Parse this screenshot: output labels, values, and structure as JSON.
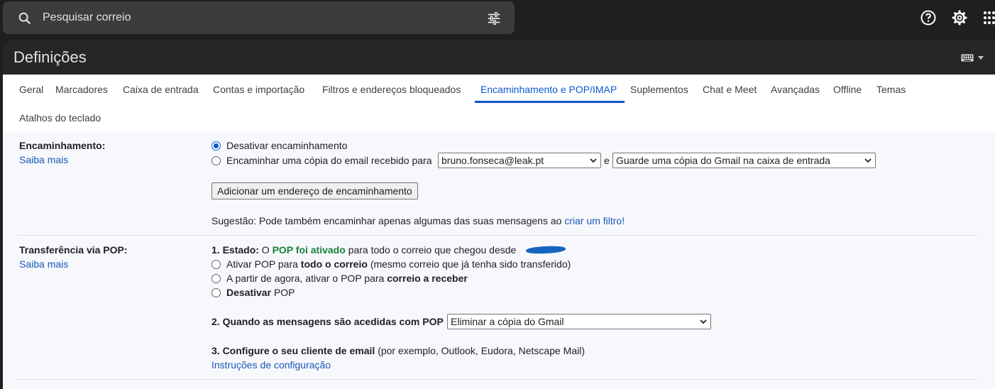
{
  "search": {
    "placeholder": "Pesquisar correio"
  },
  "header": {
    "title": "Definições"
  },
  "tabs": [
    {
      "label": "Geral"
    },
    {
      "label": "Marcadores"
    },
    {
      "label": "Caixa de entrada"
    },
    {
      "label": "Contas e importação"
    },
    {
      "label": "Filtros e endereços bloqueados"
    },
    {
      "label": "Encaminhamento e POP/IMAP",
      "active": true
    },
    {
      "label": "Suplementos"
    },
    {
      "label": "Chat e Meet"
    },
    {
      "label": "Avançadas"
    },
    {
      "label": "Offline"
    },
    {
      "label": "Temas"
    },
    {
      "label": "Atalhos do teclado"
    }
  ],
  "forwarding": {
    "label": "Encaminhamento:",
    "learn_more": "Saiba mais",
    "opt_disable": "Desativar encaminhamento",
    "opt_forward": "Encaminhar uma cópia do email recebido para",
    "address": "bruno.fonseca@leak.pt",
    "and": "e",
    "keep_option": "Guarde uma cópia do Gmail na caixa de entrada",
    "add_button": "Adicionar um endereço de encaminhamento",
    "tip_prefix": "Sugestão: Pode também encaminhar apenas algumas das suas mensagens ao",
    "tip_link": "criar um filtro!"
  },
  "pop": {
    "label": "Transferência via POP:",
    "learn_more": "Saiba mais",
    "status_label": "1. Estado:",
    "status_o": "O",
    "status_active": "POP foi ativado",
    "status_rest": "para todo o correio que chegou desde",
    "opt1_a": "Ativar POP para",
    "opt1_b": "todo o correio",
    "opt1_c": "(mesmo correio que já tenha sido transferido)",
    "opt2_a": "A partir de agora, ativar o POP para",
    "opt2_b": "correio a receber",
    "opt3_a": "Desativar",
    "opt3_b": "POP",
    "when_label": "2. Quando as mensagens são acedidas com POP",
    "when_option": "Eliminar a cópia do Gmail",
    "client_label": "3. Configure o seu cliente de email",
    "client_rest": "(por exemplo, Outlook, Eudora, Netscape Mail)",
    "instructions_link": "Instruções de configuração"
  },
  "colors": {
    "accent": "#0b57d0",
    "link": "#1a58b8",
    "pop_active": "#188038"
  }
}
